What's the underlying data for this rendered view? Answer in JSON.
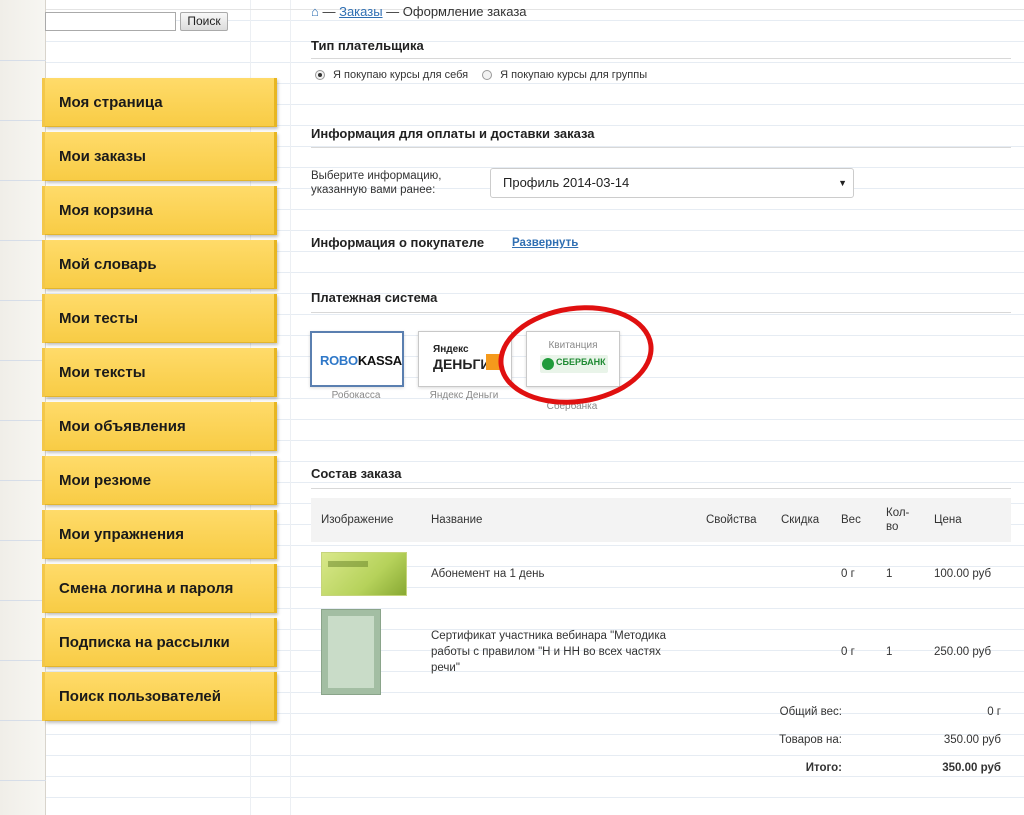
{
  "search": {
    "placeholder": "",
    "button": "Поиск"
  },
  "sidebar": {
    "items": [
      {
        "label": "Моя страница"
      },
      {
        "label": "Мои заказы"
      },
      {
        "label": "Моя корзина"
      },
      {
        "label": "Мой словарь"
      },
      {
        "label": "Мои тесты"
      },
      {
        "label": "Мои тексты"
      },
      {
        "label": "Мои объявления"
      },
      {
        "label": "Мои резюме"
      },
      {
        "label": "Мои упражнения"
      },
      {
        "label": "Смена логина и пароля"
      },
      {
        "label": "Подписка на рассылки"
      },
      {
        "label": "Поиск пользователей"
      }
    ]
  },
  "breadcrumb": {
    "home_icon": "⌂",
    "sep1": " — ",
    "link": "Заказы",
    "sep2": " — ",
    "current": "Оформление заказа"
  },
  "payer": {
    "title": "Тип плательщика",
    "option_self": "Я покупаю курсы для себя",
    "option_group": "Я покупаю курсы для группы",
    "selected": "self"
  },
  "delivery": {
    "title": "Информация для оплаты и доставки заказа",
    "select_label": "Выберите информацию, указанную вами ранее:",
    "select_value": "Профиль 2014-03-14",
    "select_arrow": "▼"
  },
  "buyer": {
    "title": "Информация о покупателе",
    "expand": "Развернуть"
  },
  "payment": {
    "title": "Платежная система",
    "systems": [
      {
        "name": "Робокасса",
        "logo_a": "ROBO",
        "logo_b": "KASSA",
        "selected": true
      },
      {
        "name": "Яндекс Деньги",
        "logo_a": "Яндекс",
        "logo_b": "ДЕНЬГИ",
        "selected": false
      },
      {
        "name": "Сбербанка",
        "logo_a": "Квитанция",
        "logo_b": "СБЕРБАНК",
        "selected": false
      }
    ]
  },
  "order": {
    "title": "Состав заказа",
    "headers": [
      "Изображение",
      "Название",
      "Свойства",
      "Скидка",
      "Вес",
      "Кол-во",
      "Цена"
    ],
    "rows": [
      {
        "name": "Абонемент на 1 день",
        "props": "",
        "discount": "",
        "weight": "0 г",
        "qty": "1",
        "price": "100.00 руб"
      },
      {
        "name": "Сертификат участника вебинара \"Методика работы с правилом \"Н и НН во всех частях речи\"",
        "props": "",
        "discount": "",
        "weight": "0 г",
        "qty": "1",
        "price": "250.00 руб"
      }
    ],
    "total_weight_label": "Общий вес:",
    "total_weight": "0 г",
    "goods_label": "Товаров на:",
    "goods_total": "350.00 руб",
    "total_label": "Итого:",
    "total": "350.00 руб"
  },
  "colors": {
    "sidebar_yellow": "#f8cc45",
    "link_blue": "#2f6fb3",
    "annotation_red": "#e01010"
  }
}
